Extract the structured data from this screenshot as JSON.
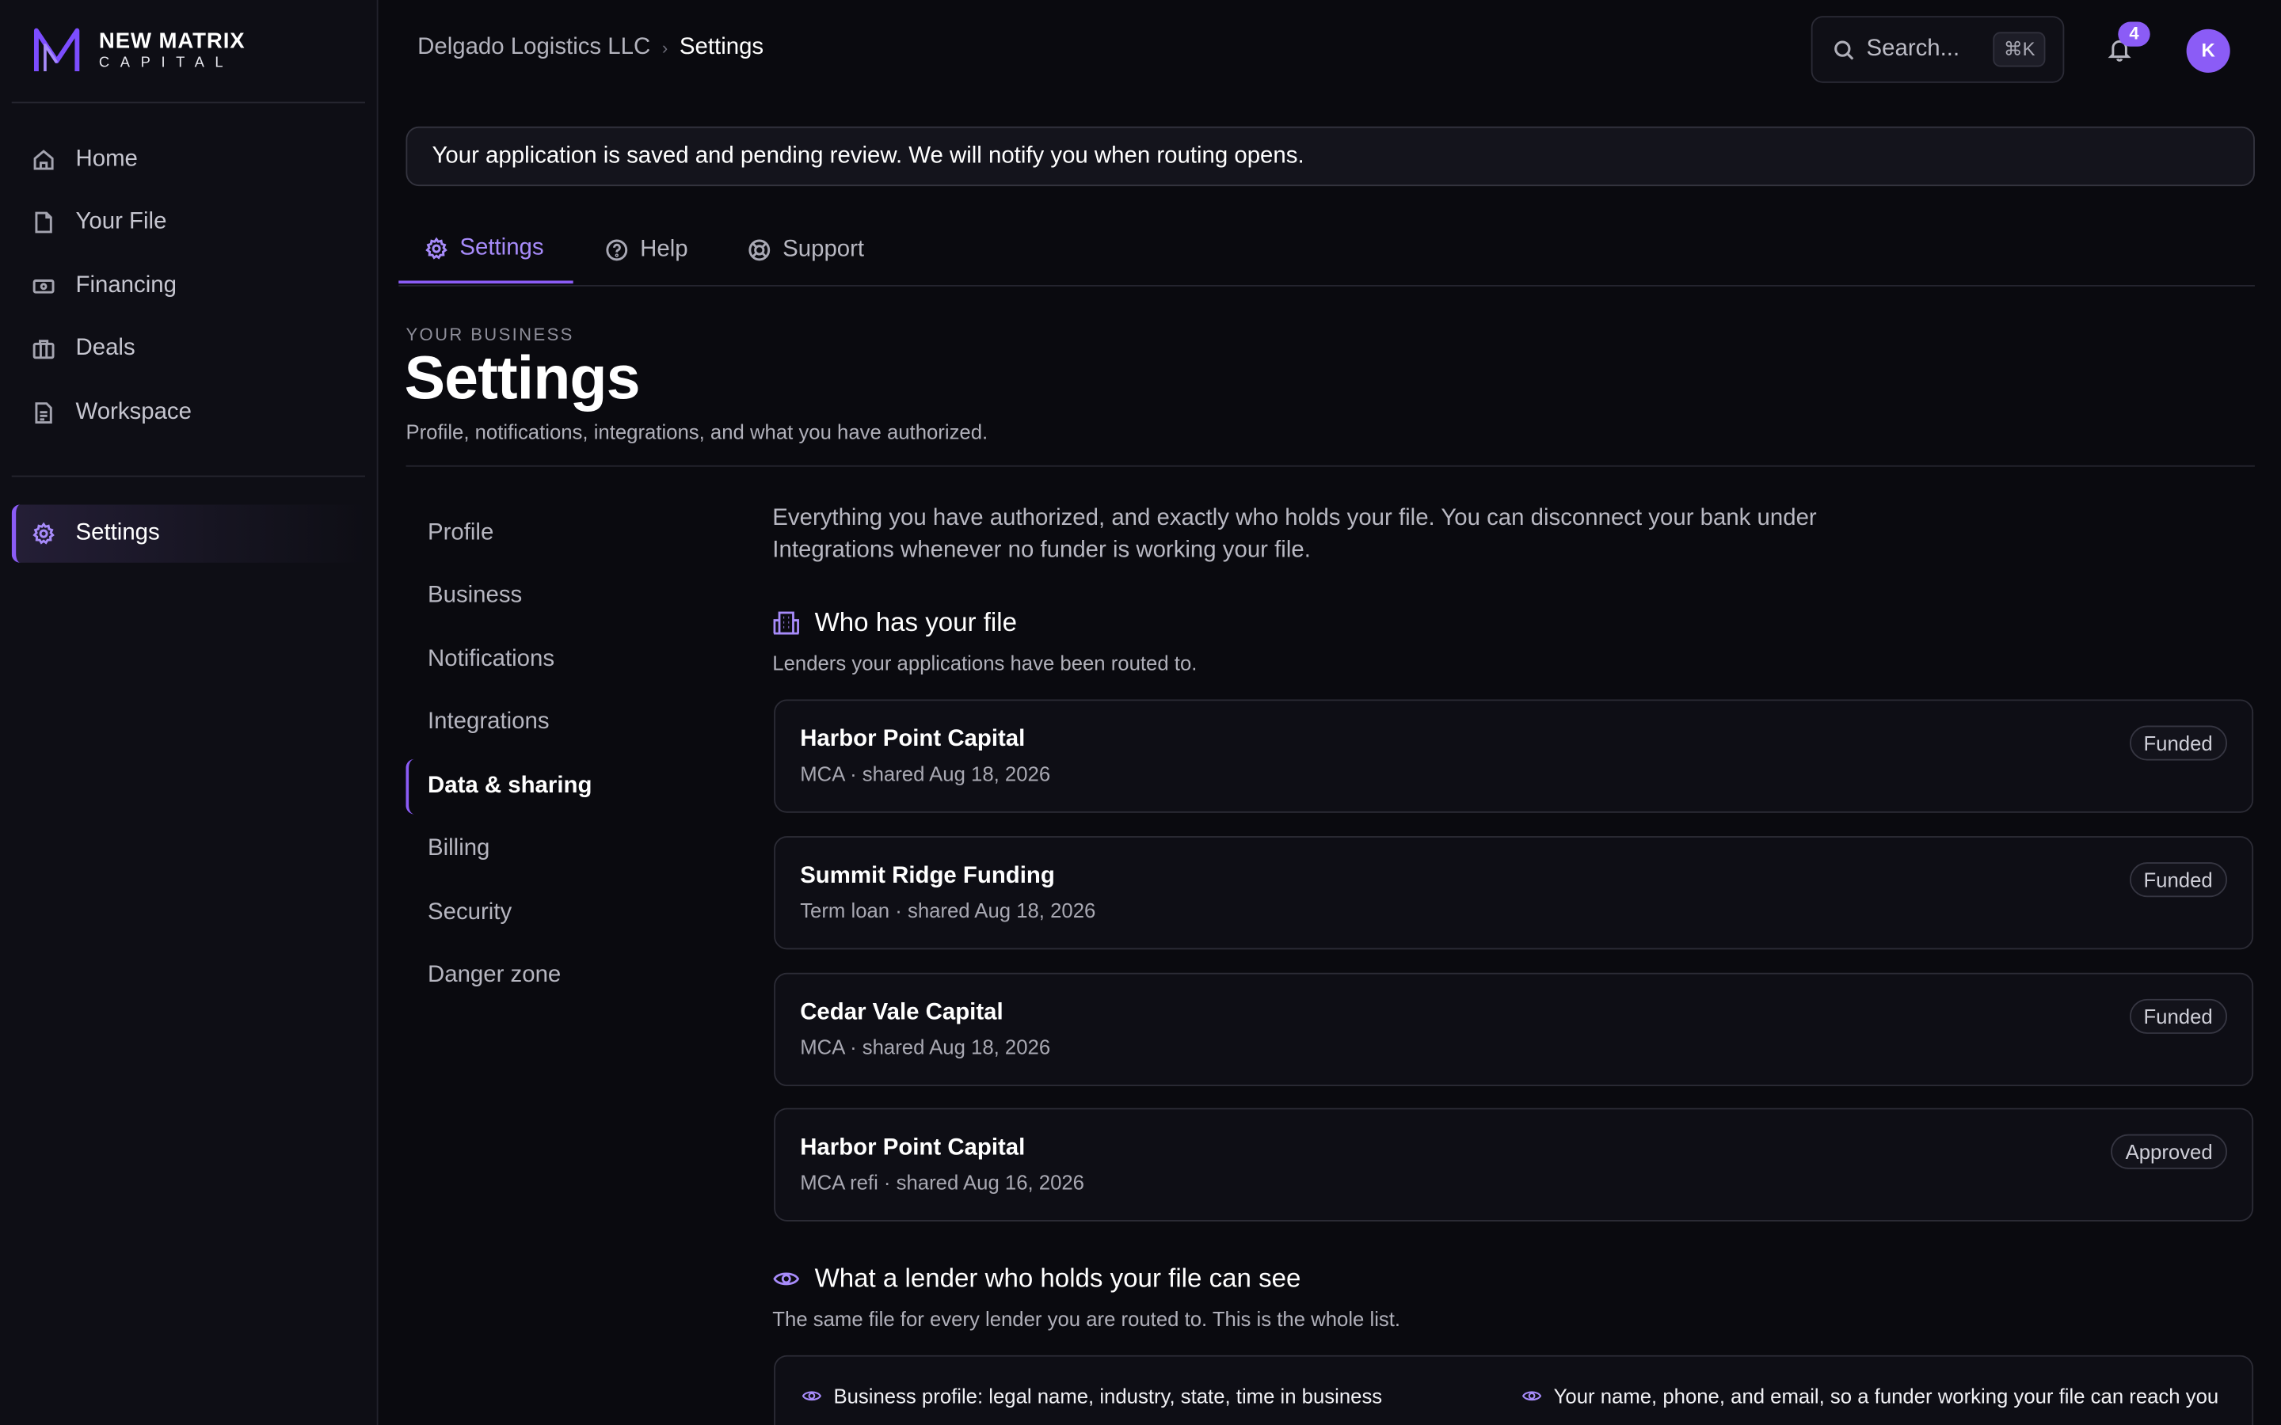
{
  "brand": {
    "name": "NEW MATRIX",
    "sub": "CAPITAL"
  },
  "sidebar": {
    "items": [
      {
        "label": "Home",
        "icon": "home-icon"
      },
      {
        "label": "Your File",
        "icon": "file-icon"
      },
      {
        "label": "Financing",
        "icon": "banknote-icon"
      },
      {
        "label": "Deals",
        "icon": "briefcase-icon"
      },
      {
        "label": "Workspace",
        "icon": "document-icon"
      }
    ],
    "settings_label": "Settings"
  },
  "topbar": {
    "breadcrumb_parent": "Delgado Logistics LLC",
    "breadcrumb_current": "Settings",
    "search_placeholder": "Search...",
    "search_shortcut": "⌘K",
    "notification_count": "4",
    "avatar_initial": "K"
  },
  "banner": {
    "text": "Your application is saved and pending review. We will notify you when routing opens."
  },
  "tabs": [
    {
      "label": "Settings",
      "icon": "gear-icon",
      "active": true
    },
    {
      "label": "Help",
      "icon": "help-circle-icon",
      "active": false
    },
    {
      "label": "Support",
      "icon": "lifebuoy-icon",
      "active": false
    }
  ],
  "header": {
    "eyebrow": "YOUR BUSINESS",
    "title": "Settings",
    "subtitle": "Profile, notifications, integrations, and what you have authorized."
  },
  "subnav": [
    "Profile",
    "Business",
    "Notifications",
    "Integrations",
    "Data & sharing",
    "Billing",
    "Security",
    "Danger zone"
  ],
  "subnav_active": "Data & sharing",
  "content": {
    "intro": "Everything you have authorized, and exactly who holds your file. You can disconnect your bank under Integrations whenever no funder is working your file.",
    "who_title": "Who has your file",
    "who_sub": "Lenders your applications have been routed to.",
    "lenders": [
      {
        "name": "Harbor Point Capital",
        "meta": "MCA · shared Aug 18, 2026",
        "status": "Funded"
      },
      {
        "name": "Summit Ridge Funding",
        "meta": "Term loan · shared Aug 18, 2026",
        "status": "Funded"
      },
      {
        "name": "Cedar Vale Capital",
        "meta": "MCA · shared Aug 18, 2026",
        "status": "Funded"
      },
      {
        "name": "Harbor Point Capital",
        "meta": "MCA refi · shared Aug 16, 2026",
        "status": "Approved"
      }
    ],
    "see_title": "What a lender who holds your file can see",
    "see_sub": "The same file for every lender you are routed to. This is the whole list.",
    "visible_items": [
      "Business profile: legal name, industry, state, time in business",
      "Your name, phone, and email, so a funder working your file can reach you"
    ]
  },
  "colors": {
    "accent": "#8b5cf6",
    "accent_light": "#a78bfa",
    "background": "#0a0a0f",
    "sidebar": "#0e0e15"
  }
}
